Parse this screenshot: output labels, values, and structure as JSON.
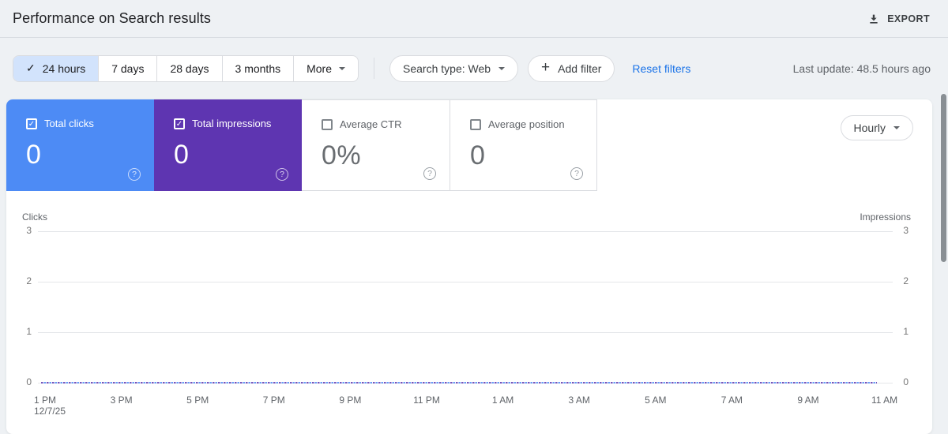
{
  "header": {
    "title": "Performance on Search results",
    "export_label": "EXPORT"
  },
  "filters": {
    "ranges": [
      {
        "label": "24 hours",
        "selected": true
      },
      {
        "label": "7 days",
        "selected": false
      },
      {
        "label": "28 days",
        "selected": false
      },
      {
        "label": "3 months",
        "selected": false
      },
      {
        "label": "More",
        "selected": false,
        "dropdown": true
      }
    ],
    "search_type_label": "Search type: Web",
    "add_filter_label": "Add filter",
    "reset_label": "Reset filters",
    "last_update": "Last update: 48.5 hours ago"
  },
  "cards": [
    {
      "label": "Total clicks",
      "value": "0",
      "checked": true,
      "bg": "#4d8bf5",
      "fg": "#ffffff"
    },
    {
      "label": "Total impressions",
      "value": "0",
      "checked": true,
      "bg": "#5e35b1",
      "fg": "#ffffff"
    },
    {
      "label": "Average CTR",
      "value": "0%",
      "checked": false,
      "bg": "#ffffff",
      "fg": "#5f6368"
    },
    {
      "label": "Average position",
      "value": "0",
      "checked": false,
      "bg": "#ffffff",
      "fg": "#5f6368"
    }
  ],
  "granularity": {
    "label": "Hourly"
  },
  "chart_data": {
    "type": "line",
    "title": "",
    "x_labels": [
      "1 PM",
      "3 PM",
      "5 PM",
      "7 PM",
      "9 PM",
      "11 PM",
      "1 AM",
      "3 AM",
      "5 AM",
      "7 AM",
      "9 AM",
      "11 AM"
    ],
    "x_sub_label": {
      "index": 0,
      "text": "12/7/25"
    },
    "left_axis": {
      "label": "Clicks",
      "ticks": [
        3,
        2,
        1,
        0
      ],
      "range": [
        0,
        3
      ]
    },
    "right_axis": {
      "label": "Impressions",
      "ticks": [
        3,
        2,
        1,
        0
      ],
      "range": [
        0,
        3
      ]
    },
    "grid": true,
    "line_style": "dashed",
    "series": [
      {
        "name": "Total impressions",
        "color": "#5e35b1",
        "values": [
          0,
          0,
          0,
          0,
          0,
          0,
          0,
          0,
          0,
          0,
          0,
          0,
          0,
          0,
          0,
          0,
          0,
          0,
          0,
          0,
          0,
          0,
          0,
          0
        ]
      },
      {
        "name": "Total clicks",
        "color": "#4d8bf5",
        "values": [
          0,
          0,
          0,
          0,
          0,
          0,
          0,
          0,
          0,
          0,
          0,
          0,
          0,
          0,
          0,
          0,
          0,
          0,
          0,
          0,
          0,
          0,
          0,
          0
        ]
      }
    ]
  }
}
